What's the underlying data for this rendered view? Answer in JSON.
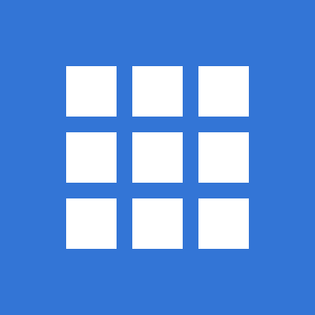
{
  "icon": {
    "name": "app-grid-icon",
    "background_color": "#3375D6",
    "square_color": "#FFFFFF",
    "rows": 3,
    "columns": 3
  }
}
